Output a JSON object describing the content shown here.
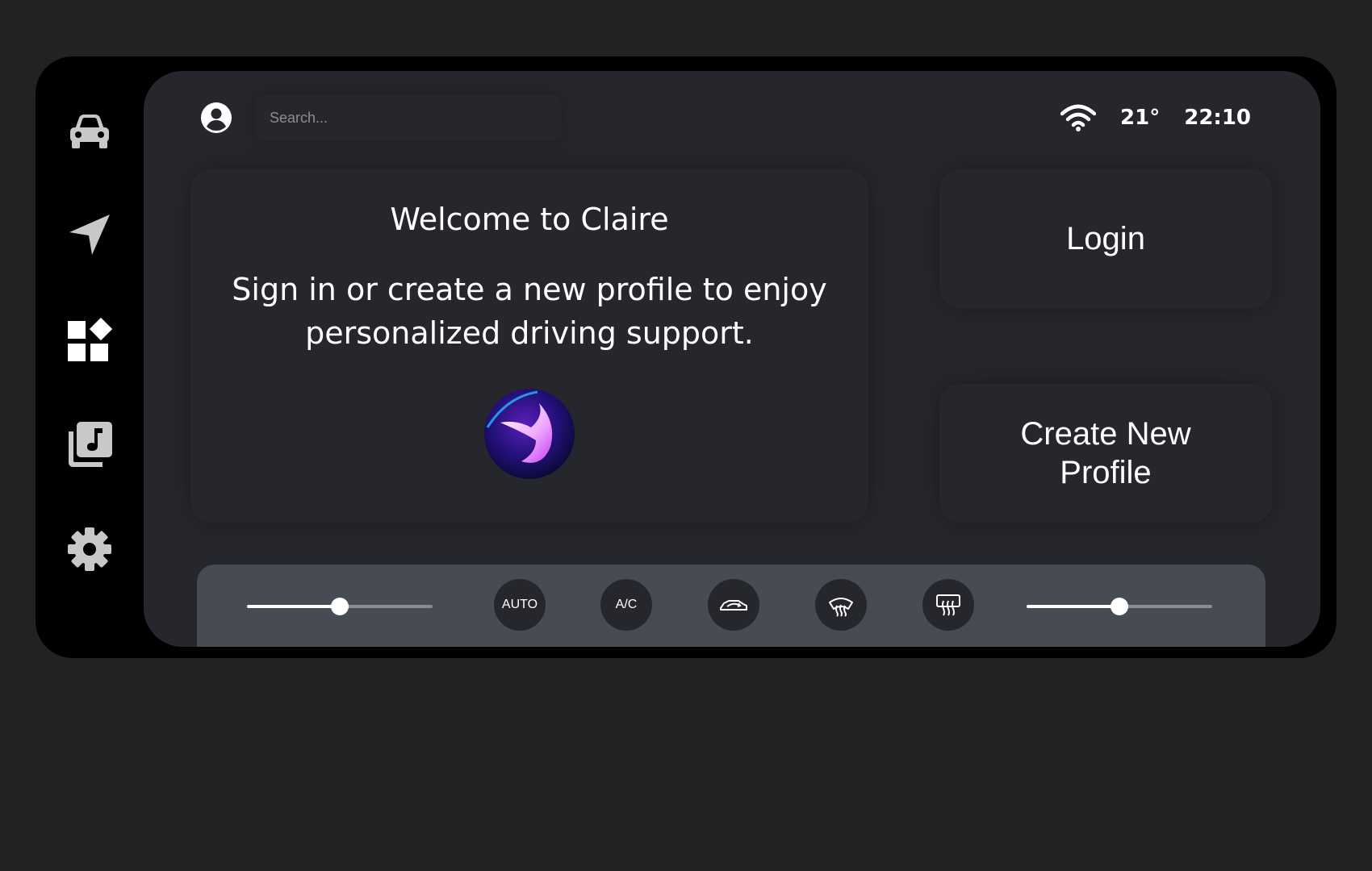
{
  "sidebar": {
    "items": [
      {
        "icon": "car-icon"
      },
      {
        "icon": "navigation-icon"
      },
      {
        "icon": "apps-icon"
      },
      {
        "icon": "music-library-icon"
      },
      {
        "icon": "gear-icon"
      }
    ]
  },
  "header": {
    "search_placeholder": "Search...",
    "temperature": "21°",
    "time": "22:10"
  },
  "welcome": {
    "title": "Welcome to Claire",
    "subtitle": "Sign in or create a new profile to enjoy personalized driving support."
  },
  "actions": {
    "login_label": "Login",
    "create_profile_label": "Create New Profile"
  },
  "climate": {
    "left_slider_value": 0.5,
    "right_slider_value": 0.5,
    "auto_label": "AUTO",
    "ac_label": "A/C"
  },
  "colors": {
    "background": "#222222",
    "frame": "#000000",
    "screen": "#25272c",
    "climate_bar": "#474b53",
    "accent": "#ffffff"
  }
}
